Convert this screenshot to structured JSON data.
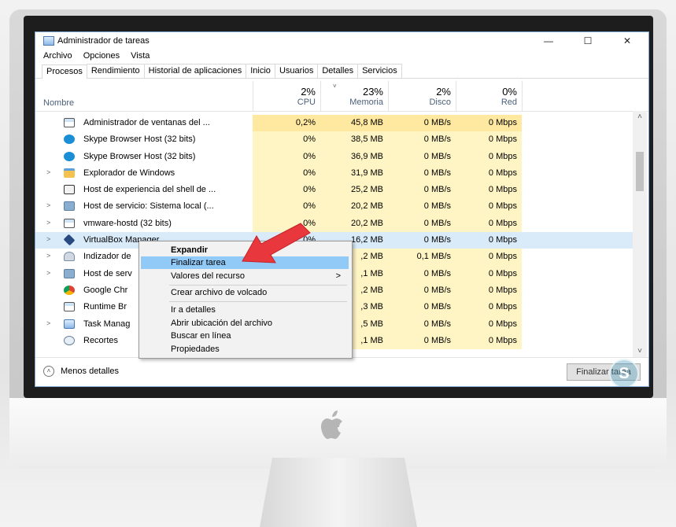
{
  "window": {
    "title": "Administrador de tareas",
    "minimize": "—",
    "maximize": "☐",
    "close": "✕"
  },
  "menu": [
    "Archivo",
    "Opciones",
    "Vista"
  ],
  "tabs": [
    "Procesos",
    "Rendimiento",
    "Historial de aplicaciones",
    "Inicio",
    "Usuarios",
    "Detalles",
    "Servicios"
  ],
  "columns": {
    "name": "Nombre",
    "cpu": {
      "pct": "2%",
      "label": "CPU"
    },
    "mem": {
      "pct": "23%",
      "label": "Memoria"
    },
    "disk": {
      "pct": "2%",
      "label": "Disco"
    },
    "net": {
      "pct": "0%",
      "label": "Red"
    }
  },
  "rows": [
    {
      "expand": "",
      "icon": "window-icon",
      "name": "Administrador de ventanas del ...",
      "cpu": "0,2%",
      "mem": "45,8 MB",
      "disk": "0 MB/s",
      "net": "0 Mbps"
    },
    {
      "expand": "",
      "icon": "skype-icon",
      "name": "Skype Browser Host (32 bits)",
      "cpu": "0%",
      "mem": "38,5 MB",
      "disk": "0 MB/s",
      "net": "0 Mbps"
    },
    {
      "expand": "",
      "icon": "skype-icon",
      "name": "Skype Browser Host (32 bits)",
      "cpu": "0%",
      "mem": "36,9 MB",
      "disk": "0 MB/s",
      "net": "0 Mbps"
    },
    {
      "expand": ">",
      "icon": "folder-icon",
      "name": "Explorador de Windows",
      "cpu": "0%",
      "mem": "31,9 MB",
      "disk": "0 MB/s",
      "net": "0 Mbps"
    },
    {
      "expand": "",
      "icon": "shell-icon",
      "name": "Host de experiencia del shell de ...",
      "cpu": "0%",
      "mem": "25,2 MB",
      "disk": "0 MB/s",
      "net": "0 Mbps"
    },
    {
      "expand": ">",
      "icon": "gear-icon",
      "name": "Host de servicio: Sistema local (...",
      "cpu": "0%",
      "mem": "20,2 MB",
      "disk": "0 MB/s",
      "net": "0 Mbps"
    },
    {
      "expand": ">",
      "icon": "window-icon",
      "name": "vmware-hostd (32 bits)",
      "cpu": "0%",
      "mem": "20,2 MB",
      "disk": "0 MB/s",
      "net": "0 Mbps"
    },
    {
      "expand": ">",
      "icon": "virtualbox-icon",
      "name": "VirtualBox Manager",
      "cpu": "0%",
      "mem": "16,2 MB",
      "disk": "0 MB/s",
      "net": "0 Mbps"
    },
    {
      "expand": ">",
      "icon": "indexer-icon",
      "name": "Indizador de",
      "cpu": "",
      "mem": ",2 MB",
      "disk": "0,1 MB/s",
      "net": "0 Mbps"
    },
    {
      "expand": ">",
      "icon": "gear-icon",
      "name": "Host de serv",
      "cpu": "",
      "mem": ",1 MB",
      "disk": "0 MB/s",
      "net": "0 Mbps"
    },
    {
      "expand": "",
      "icon": "chrome-icon",
      "name": "Google Chr",
      "cpu": "",
      "mem": ",2 MB",
      "disk": "0 MB/s",
      "net": "0 Mbps"
    },
    {
      "expand": "",
      "icon": "window-icon",
      "name": "Runtime Br",
      "cpu": "",
      "mem": ",3 MB",
      "disk": "0 MB/s",
      "net": "0 Mbps"
    },
    {
      "expand": ">",
      "icon": "taskmgr-icon",
      "name": "Task Manag",
      "cpu": "",
      "mem": ",5 MB",
      "disk": "0 MB/s",
      "net": "0 Mbps"
    },
    {
      "expand": "",
      "icon": "scissors-icon",
      "name": "Recortes",
      "cpu": "",
      "mem": ",1 MB",
      "disk": "0 MB/s",
      "net": "0 Mbps"
    }
  ],
  "context_menu": {
    "expand": "Expandir",
    "end_task": "Finalizar tarea",
    "resource_values": "Valores del recurso",
    "submenu_arrow": ">",
    "dump": "Crear archivo de volcado",
    "details": "Ir a detalles",
    "open_location": "Abrir ubicación del archivo",
    "search_online": "Buscar en línea",
    "properties": "Propiedades"
  },
  "footer": {
    "less_details": "Menos detalles",
    "end_task_button": "Finalizar tarea"
  },
  "watermark": "S",
  "colors": {
    "accent_blue": "#91c9f7",
    "selected_row": "#d9ebf9",
    "arrow_red": "#e8383d",
    "cpu_heat": "#fff4c4"
  }
}
